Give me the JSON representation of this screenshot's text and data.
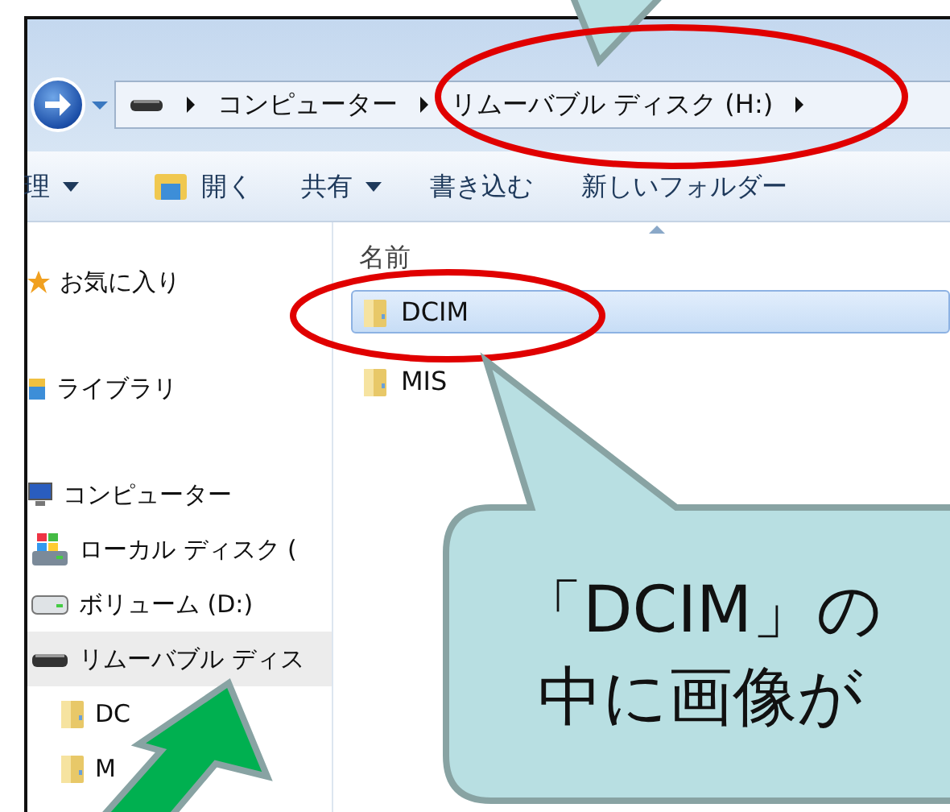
{
  "address_bar": {
    "segments": [
      {
        "label": "コンピューター"
      },
      {
        "label": "リムーバブル ディスク (H:)"
      }
    ]
  },
  "toolbar": [
    {
      "label": "理",
      "kind": "menu"
    },
    {
      "label": "開く",
      "kind": "open"
    },
    {
      "label": "共有",
      "kind": "menu"
    },
    {
      "label": "書き込む",
      "kind": "plain"
    },
    {
      "label": "新しいフォルダー",
      "kind": "plain"
    }
  ],
  "nav_pane": {
    "groups": [
      [
        {
          "label": "お気に入り",
          "kind": "favorites",
          "selected": false
        }
      ],
      [
        {
          "label": "ライブラリ",
          "kind": "libraries",
          "selected": false
        }
      ],
      [
        {
          "label": "コンピューター",
          "kind": "computer",
          "selected": false,
          "children": [
            {
              "label": "ローカル ディスク (",
              "kind": "system_disk",
              "selected": false
            },
            {
              "label": "ボリューム (D:)",
              "kind": "disk",
              "selected": false
            },
            {
              "label": "リムーバブル ディス",
              "kind": "removable",
              "selected": true,
              "children": [
                {
                  "label": "DC",
                  "kind": "folder",
                  "selected": false
                },
                {
                  "label": "M",
                  "kind": "folder",
                  "selected": false
                }
              ]
            }
          ]
        }
      ]
    ]
  },
  "file_list": {
    "column": "名前",
    "files": [
      {
        "name": "DCIM",
        "selected": true
      },
      {
        "name": "MIS",
        "selected": false
      }
    ]
  },
  "callout": {
    "lines": [
      "「DCIM」の",
      "中に画像が"
    ]
  }
}
